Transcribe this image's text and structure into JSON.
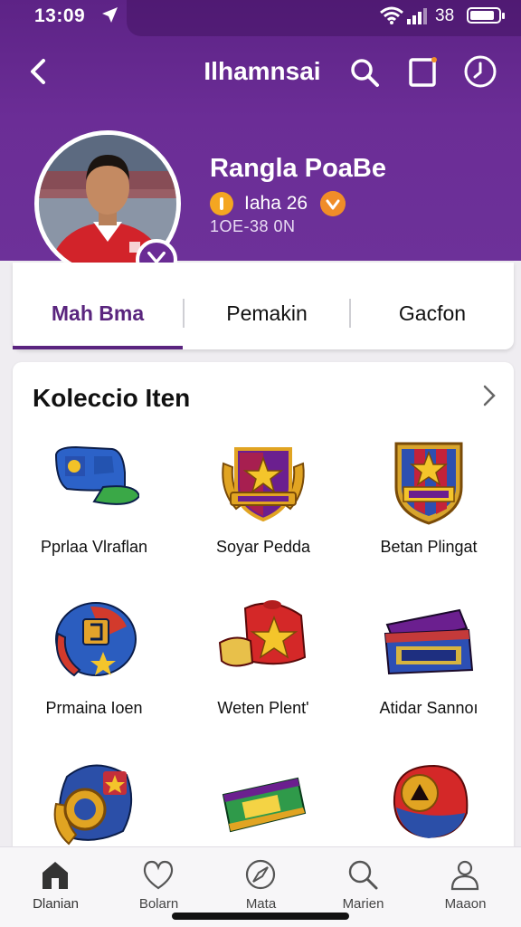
{
  "status_bar": {
    "time": "13:09",
    "battery_text": "38",
    "battery_level": 0.85
  },
  "top_bar": {
    "title": "Ilhamnsai"
  },
  "profile": {
    "name": "Rangla PoaBe",
    "rank_text": "Iaha 26",
    "subtitle": "1OE-38 0N"
  },
  "tabs": [
    {
      "label": "Mah Bma",
      "active": true
    },
    {
      "label": "Pemakin",
      "active": false
    },
    {
      "label": "Gacfon",
      "active": false
    }
  ],
  "collection": {
    "title": "Koleccio Iten",
    "items": [
      {
        "label": "Pprlaa Vlraflan",
        "icon": "blue-cap-icon"
      },
      {
        "label": "Soyar Pedda",
        "icon": "winged-shield-emblem-icon"
      },
      {
        "label": "Betan Plingat",
        "icon": "crest-badge-icon"
      },
      {
        "label": "Prmaina Ioen",
        "icon": "helmet-icon"
      },
      {
        "label": "Weten Plent'",
        "icon": "red-cap-star-icon"
      },
      {
        "label": "Atidar Sannoı",
        "icon": "ticket-banner-icon"
      },
      {
        "label": "",
        "icon": "armor-helmet-icon"
      },
      {
        "label": "",
        "icon": "green-ticket-icon"
      },
      {
        "label": "",
        "icon": "red-helmet-icon"
      }
    ]
  },
  "bottom_nav": [
    {
      "label": "Dlanian",
      "icon": "home-icon",
      "active": true
    },
    {
      "label": "Bolarn",
      "icon": "heart-icon",
      "active": false
    },
    {
      "label": "Mata",
      "icon": "compass-icon",
      "active": false
    },
    {
      "label": "Marien",
      "icon": "search-icon",
      "active": false
    },
    {
      "label": "Maaon",
      "icon": "profile-icon",
      "active": false
    }
  ],
  "colors": {
    "primary": "#6b2d96",
    "accent_orange": "#f4a621",
    "tab_active": "#5a257e"
  }
}
